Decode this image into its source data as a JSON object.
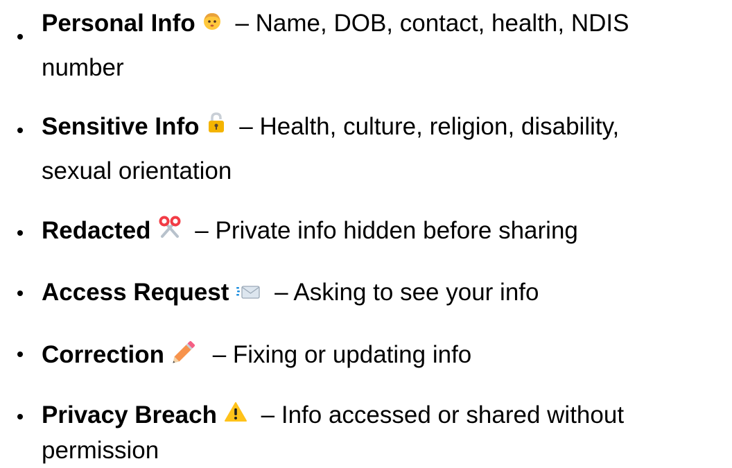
{
  "items": [
    {
      "term": "Personal Info",
      "icon": "person-face-icon",
      "desc_line1": " – Name, DOB, contact, health, NDIS",
      "desc_line2": "number"
    },
    {
      "term": "Sensitive Info",
      "icon": "padlock-icon",
      "desc_line1": " – Health, culture, religion, disability,",
      "desc_line2": "sexual orientation"
    },
    {
      "term": "Redacted",
      "icon": "scissors-icon",
      "desc_line1": " – Private info hidden before sharing",
      "desc_line2": ""
    },
    {
      "term": "Access Request",
      "icon": "incoming-envelope-icon",
      "desc_line1": " – Asking to see your info",
      "desc_line2": ""
    },
    {
      "term": "Correction",
      "icon": "pencil-icon",
      "desc_line1": " – Fixing or updating info",
      "desc_line2": ""
    },
    {
      "term": "Privacy Breach",
      "icon": "warning-icon",
      "desc_line1": " – Info accessed or shared without",
      "desc_line2": "permission"
    }
  ],
  "colors": {
    "text": "#000000",
    "face": "#FFC83D",
    "hair": "#E9A23B",
    "lock": "#F4B400",
    "scissors_handle": "#F23B45",
    "scissors_blade": "#B8C2CC",
    "envelope": "#DDE6EF",
    "pencil": "#F7934C",
    "pencil_eraser": "#F55F84",
    "warning": "#FFC21A"
  }
}
